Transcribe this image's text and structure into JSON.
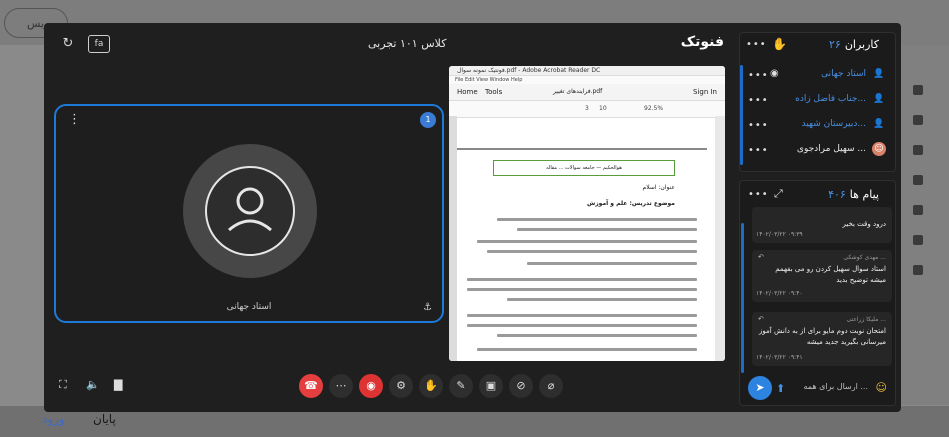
{
  "background": {
    "top_button_label": "ویس",
    "bottom_row": [
      "پایان",
      "ورود"
    ]
  },
  "modal": {
    "brand": "فنوتک",
    "class_title": "کلاس ۱۰۱ تجربی",
    "icons": [
      "refresh-icon",
      "fa-toggle"
    ],
    "fa_label": "fa"
  },
  "video": {
    "participant_name": "استاد جهانی",
    "badge": "1"
  },
  "screen_share": {
    "window_title": "فونتیک نمونه سوال.pdf - Adobe Acrobat Reader DC",
    "menu": "File  Edit  View  Window  Help",
    "tabs": [
      "Home",
      "Tools",
      "فرایندهای تغییر.pdf",
      "Sign In"
    ],
    "page": "3",
    "pages_total": "10",
    "zoom": "92.5%",
    "doc_header": "هوالحکیم — جامعه سوالات ... مقاله",
    "doc_lines": [
      "عنوان: اسلام",
      "موضوع تدریس: علم و آموزش"
    ]
  },
  "controls": {
    "left": [
      "fullscreen-icon",
      "speaker-icon",
      "signal-icon"
    ],
    "center": [
      "end-call-icon",
      "more-icon",
      "record-icon",
      "settings-icon",
      "hand-icon",
      "pen-icon",
      "share-screen-icon",
      "camera-off-icon",
      "mic-off-icon"
    ]
  },
  "users_panel": {
    "title": "کاربران",
    "count": "۲۶",
    "users": [
      {
        "name": "استاد جهانی",
        "color": "#4a90e2"
      },
      {
        "name": "جناب فاضل زاده...",
        "color": "#4a90e2"
      },
      {
        "name": "دبیرستان شهید...",
        "color": "#4a90e2"
      },
      {
        "name": "سهیل مرادجوی ...",
        "color": "#e8e8e8"
      }
    ]
  },
  "messages_panel": {
    "title": "پیام ها",
    "count": "۴۰۶",
    "messages": [
      {
        "who": "",
        "text": "درود وقت بخیر",
        "time": "۱۴۰۲/۰۳/۲۲ ۰۹:۳۹"
      },
      {
        "who": "مهدی کوشکی ...",
        "text": "استاد سوال سهیل کردن رو می‌ بفهمم میشه توضیح بدید",
        "time": "۱۴۰۲/۰۳/۲۲ ۰۹:۴۰"
      },
      {
        "who": "ملیکا زراعتی ...",
        "text": "امتحان نوبت دوم مایو برای از به دانش آموز میرسانی بگیرید جدید میشه",
        "time": "۱۴۰۲/۰۳/۲۲ ۰۹:۴۱"
      }
    ],
    "input_placeholder": "ارسال برای همه ..."
  }
}
